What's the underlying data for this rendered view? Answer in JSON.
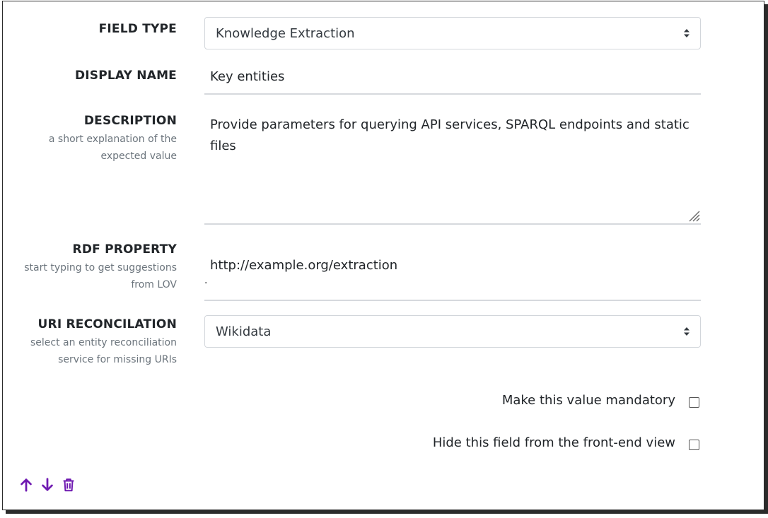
{
  "field_type": {
    "label": "FIELD TYPE",
    "value": "Knowledge Extraction"
  },
  "display_name": {
    "label": "DISPLAY NAME",
    "value": "Key entities"
  },
  "description": {
    "label": "DESCRIPTION",
    "help": "a short explanation of the expected value",
    "value": "Provide parameters for querying API services, SPARQL endpoints and static files"
  },
  "rdf_property": {
    "label": "RDF PROPERTY",
    "help": "start typing to get suggestions from LOV",
    "value": "http://example.org/extraction",
    "dot": "."
  },
  "uri_reconciliation": {
    "label": "URI RECONCILATION",
    "help": "select an entity reconciliation service for missing URIs",
    "value": "Wikidata"
  },
  "options": {
    "mandatory_label": "Make this value mandatory",
    "mandatory_checked": false,
    "hide_label": "Hide this field from the front-end view",
    "hide_checked": false
  },
  "icons": {
    "up": "arrow-up-icon",
    "down": "arrow-down-icon",
    "delete": "trash-icon"
  },
  "colors": {
    "accent": "#6f1ab1"
  }
}
